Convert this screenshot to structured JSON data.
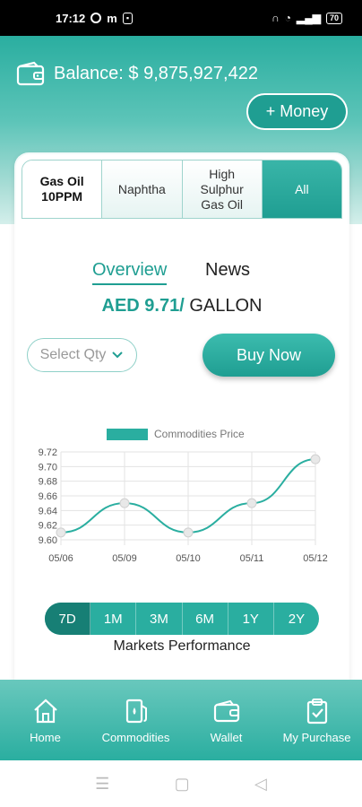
{
  "status_bar": {
    "time": "17:12",
    "battery": "70"
  },
  "balance": {
    "label": "Balance: $ 9,875,927,422"
  },
  "add_money_label": "+ Money",
  "tabs": [
    {
      "label": "Gas Oil 10PPM",
      "active": true
    },
    {
      "label": "Naphtha",
      "active": false
    },
    {
      "label": "High Sulphur Gas Oil",
      "active": false
    },
    {
      "label": "All",
      "active": false
    }
  ],
  "segments": {
    "overview": "Overview",
    "news": "News"
  },
  "price": {
    "value": "AED 9.71/",
    "unit": " GALLON"
  },
  "qty_placeholder": "Select Qty",
  "buy_now_label": "Buy Now",
  "chart_data": {
    "type": "line",
    "legend": [
      "Commodities Price"
    ],
    "categories": [
      "05/06",
      "05/09",
      "05/10",
      "05/11",
      "05/12"
    ],
    "series": [
      {
        "name": "Commodities Price",
        "values": [
          9.61,
          9.65,
          9.61,
          9.65,
          9.71
        ]
      }
    ],
    "ylim": [
      9.6,
      9.72
    ],
    "yticks": [
      "9.72",
      "9.70",
      "9.68",
      "9.66",
      "9.64",
      "9.62",
      "9.60"
    ],
    "grid": true,
    "color": "#2aaea0"
  },
  "periods": [
    {
      "label": "7D",
      "active": true
    },
    {
      "label": "1M",
      "active": false
    },
    {
      "label": "3M",
      "active": false
    },
    {
      "label": "6M",
      "active": false
    },
    {
      "label": "1Y",
      "active": false
    },
    {
      "label": "2Y",
      "active": false
    }
  ],
  "markets_performance": "Markets Performance",
  "nav": [
    {
      "label": "Home",
      "icon": "home-icon"
    },
    {
      "label": "Commodities",
      "icon": "fuel-icon"
    },
    {
      "label": "Wallet",
      "icon": "wallet-icon"
    },
    {
      "label": "My Purchase",
      "icon": "clipboard-check-icon"
    }
  ]
}
